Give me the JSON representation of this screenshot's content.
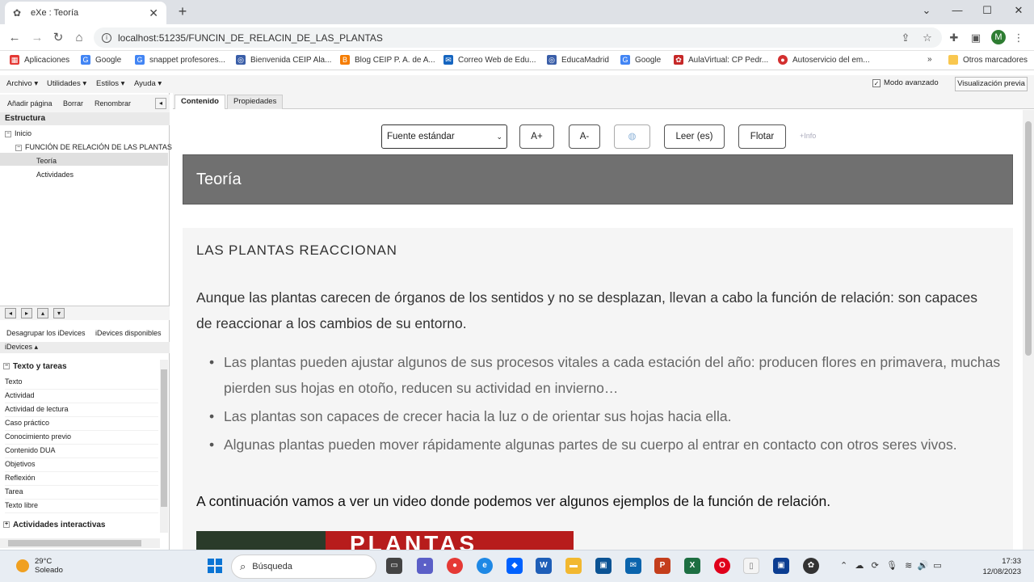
{
  "browser": {
    "tab_title": "eXe : Teoría",
    "url": "localhost:51235/FUNCIN_DE_RELACIN_DE_LAS_PLANTAS",
    "profile_initial": "M",
    "bookmarks": [
      "Aplicaciones",
      "Google",
      "snappet profesores...",
      "Bienvenida CEIP Ala...",
      "Blog CEIP P. A. de A...",
      "Correo Web de Edu...",
      "EducaMadrid",
      "Google",
      "AulaVirtual: CP Pedr...",
      "Autoservicio del em...",
      "Otros marcadores"
    ],
    "bookmark_overflow": "»"
  },
  "exe_menu": {
    "items": [
      "Archivo ▾",
      "Utilidades ▾",
      "Estilos ▾",
      "Ayuda ▾"
    ],
    "advanced_mode": "Modo avanzado",
    "preview": "Visualización previa"
  },
  "left_panel": {
    "actions": [
      "Añadir página",
      "Borrar",
      "Renombrar"
    ],
    "structure_title": "Estructura",
    "tree": [
      "Inicio",
      "FUNCIÓN DE RELACIÓN DE LAS PLANTAS",
      "Teoría",
      "Actividades"
    ],
    "idevice_tabs": [
      "Desagrupar los iDevices",
      "iDevices disponibles"
    ],
    "idevices_header": "iDevices ▴",
    "category_1": "Texto y tareas",
    "idevices": [
      "Texto",
      "Actividad",
      "Actividad de lectura",
      "Caso práctico",
      "Conocimiento previo",
      "Contenido DUA",
      "Objetivos",
      "Reflexión",
      "Tarea",
      "Texto libre"
    ],
    "category_2": "Actividades interactivas"
  },
  "content_tabs": [
    "Contenido",
    "Propiedades"
  ],
  "toolbar": {
    "font_select": "Fuente estándar",
    "font_plus": "A+",
    "font_minus": "A-",
    "read": "Leer (es)",
    "float": "Flotar",
    "more_info": "+Info"
  },
  "page": {
    "title": "Teoría",
    "heading": "LAS PLANTAS REACCIONAN",
    "intro": "Aunque las plantas carecen de órganos de los sentidos y no se desplazan, llevan a cabo la función de relación: son capaces de reaccionar a los cambios de su entorno.",
    "bullets": [
      "Las plantas pueden ajustar algunos de sus procesos vitales a cada estación del año: producen flores en primavera, muchas pierden sus hojas en otoño, reducen su actividad en invierno…",
      "Las plantas son capaces de crecer hacia la luz o de orientar sus hojas hacia ella.",
      "Algunas plantas pueden mover rápidamente algunas partes de su cuerpo al entrar en contacto con otros seres vivos."
    ],
    "continuation": "A continuación vamos a ver un video donde podemos ver algunos ejemplos de la función de relación.",
    "video_banner": "PLANTAS"
  },
  "taskbar": {
    "temperature": "29°C",
    "weather": "Soleado",
    "search": "Búsqueda",
    "time": "17:33",
    "date": "12/08/2023"
  },
  "colors": {
    "header_bg": "#707070",
    "body_bg": "#f5f5f5",
    "taskbar_bg": "#e8edf3"
  }
}
